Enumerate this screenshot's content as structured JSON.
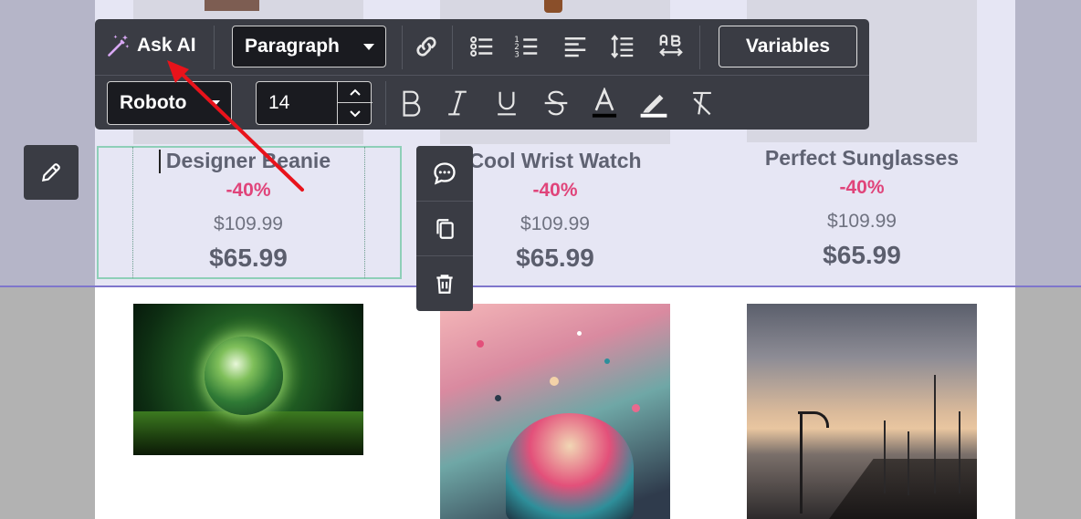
{
  "colors": {
    "toolbar_bg": "#3a3c44",
    "discount": "#e0447a",
    "selection_border": "#8ecfb8",
    "divider": "#7f76cc",
    "annotation_arrow": "#e8131b"
  },
  "toolbar": {
    "ask_ai_label": "Ask AI",
    "block_type": "Paragraph",
    "variables_label": "Variables",
    "font_family": "Roboto",
    "font_size": "14",
    "icons": [
      "magic-wand-icon",
      "link-icon",
      "bulleted-list-icon",
      "numbered-list-icon",
      "align-left-icon",
      "line-height-icon",
      "letter-spacing-icon",
      "bold-icon",
      "italic-icon",
      "underline-icon",
      "strikethrough-icon",
      "text-color-icon",
      "highlight-icon",
      "clear-format-icon"
    ]
  },
  "products": [
    {
      "name": "Designer Beanie",
      "discount": "-40%",
      "old_price": "$109.99",
      "new_price": "$65.99"
    },
    {
      "name": "Cool Wrist Watch",
      "discount": "-40%",
      "old_price": "$109.99",
      "new_price": "$65.99"
    },
    {
      "name": "Perfect Sunglasses",
      "discount": "-40%",
      "old_price": "$109.99",
      "new_price": "$65.99"
    }
  ],
  "side_tools": [
    "comment-icon",
    "duplicate-icon",
    "delete-icon"
  ],
  "edit_button_icon": "pencil-icon"
}
